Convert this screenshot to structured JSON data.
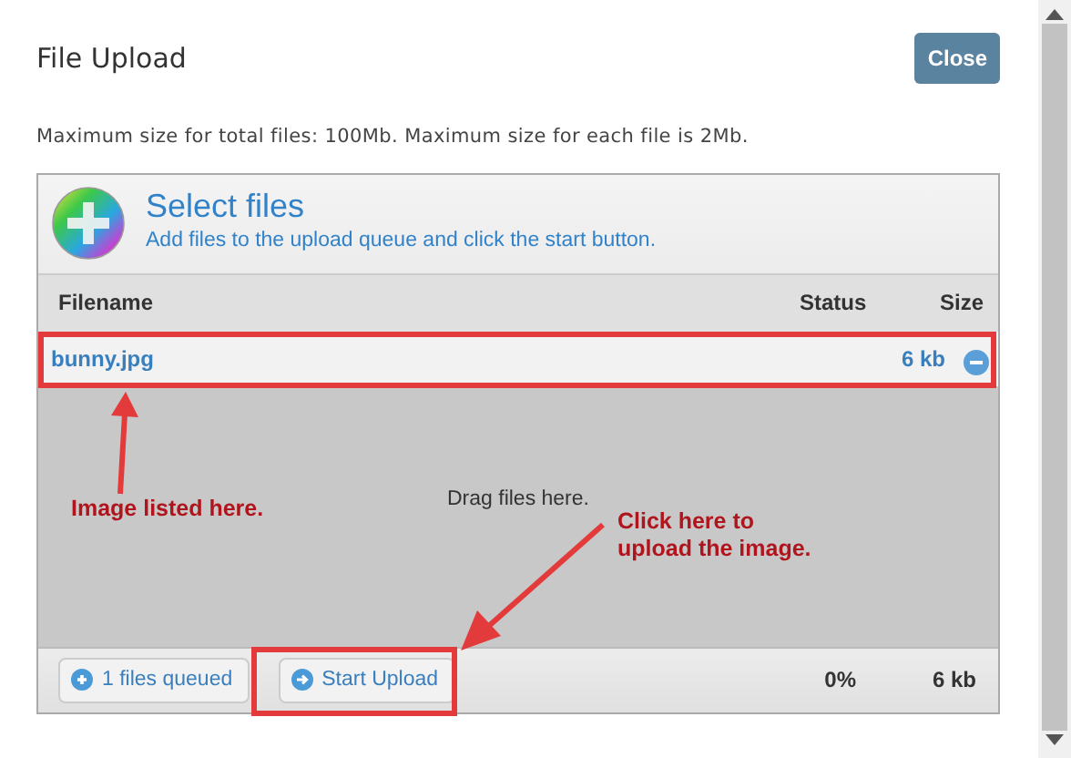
{
  "dialog": {
    "title": "File Upload",
    "close_button": "Close"
  },
  "limits_text": "Maximum size for total files: 100Mb. Maximum size for each file is 2Mb.",
  "uploader": {
    "header_title": "Select files",
    "header_subtitle": "Add files to the upload queue and click the start button.",
    "columns": [
      "Filename",
      "Status",
      "Size"
    ],
    "files": [
      {
        "name": "bunny.jpg",
        "size": "6 kb"
      }
    ],
    "drop_hint": "Drag files here.",
    "footer": {
      "add_button": "1 files queued",
      "start_button": "Start Upload",
      "percent": "0%",
      "total_size": "6 kb"
    }
  },
  "annotations": [
    {
      "text": "Image listed here."
    },
    {
      "text": "Click here to\nupload the image."
    }
  ]
}
